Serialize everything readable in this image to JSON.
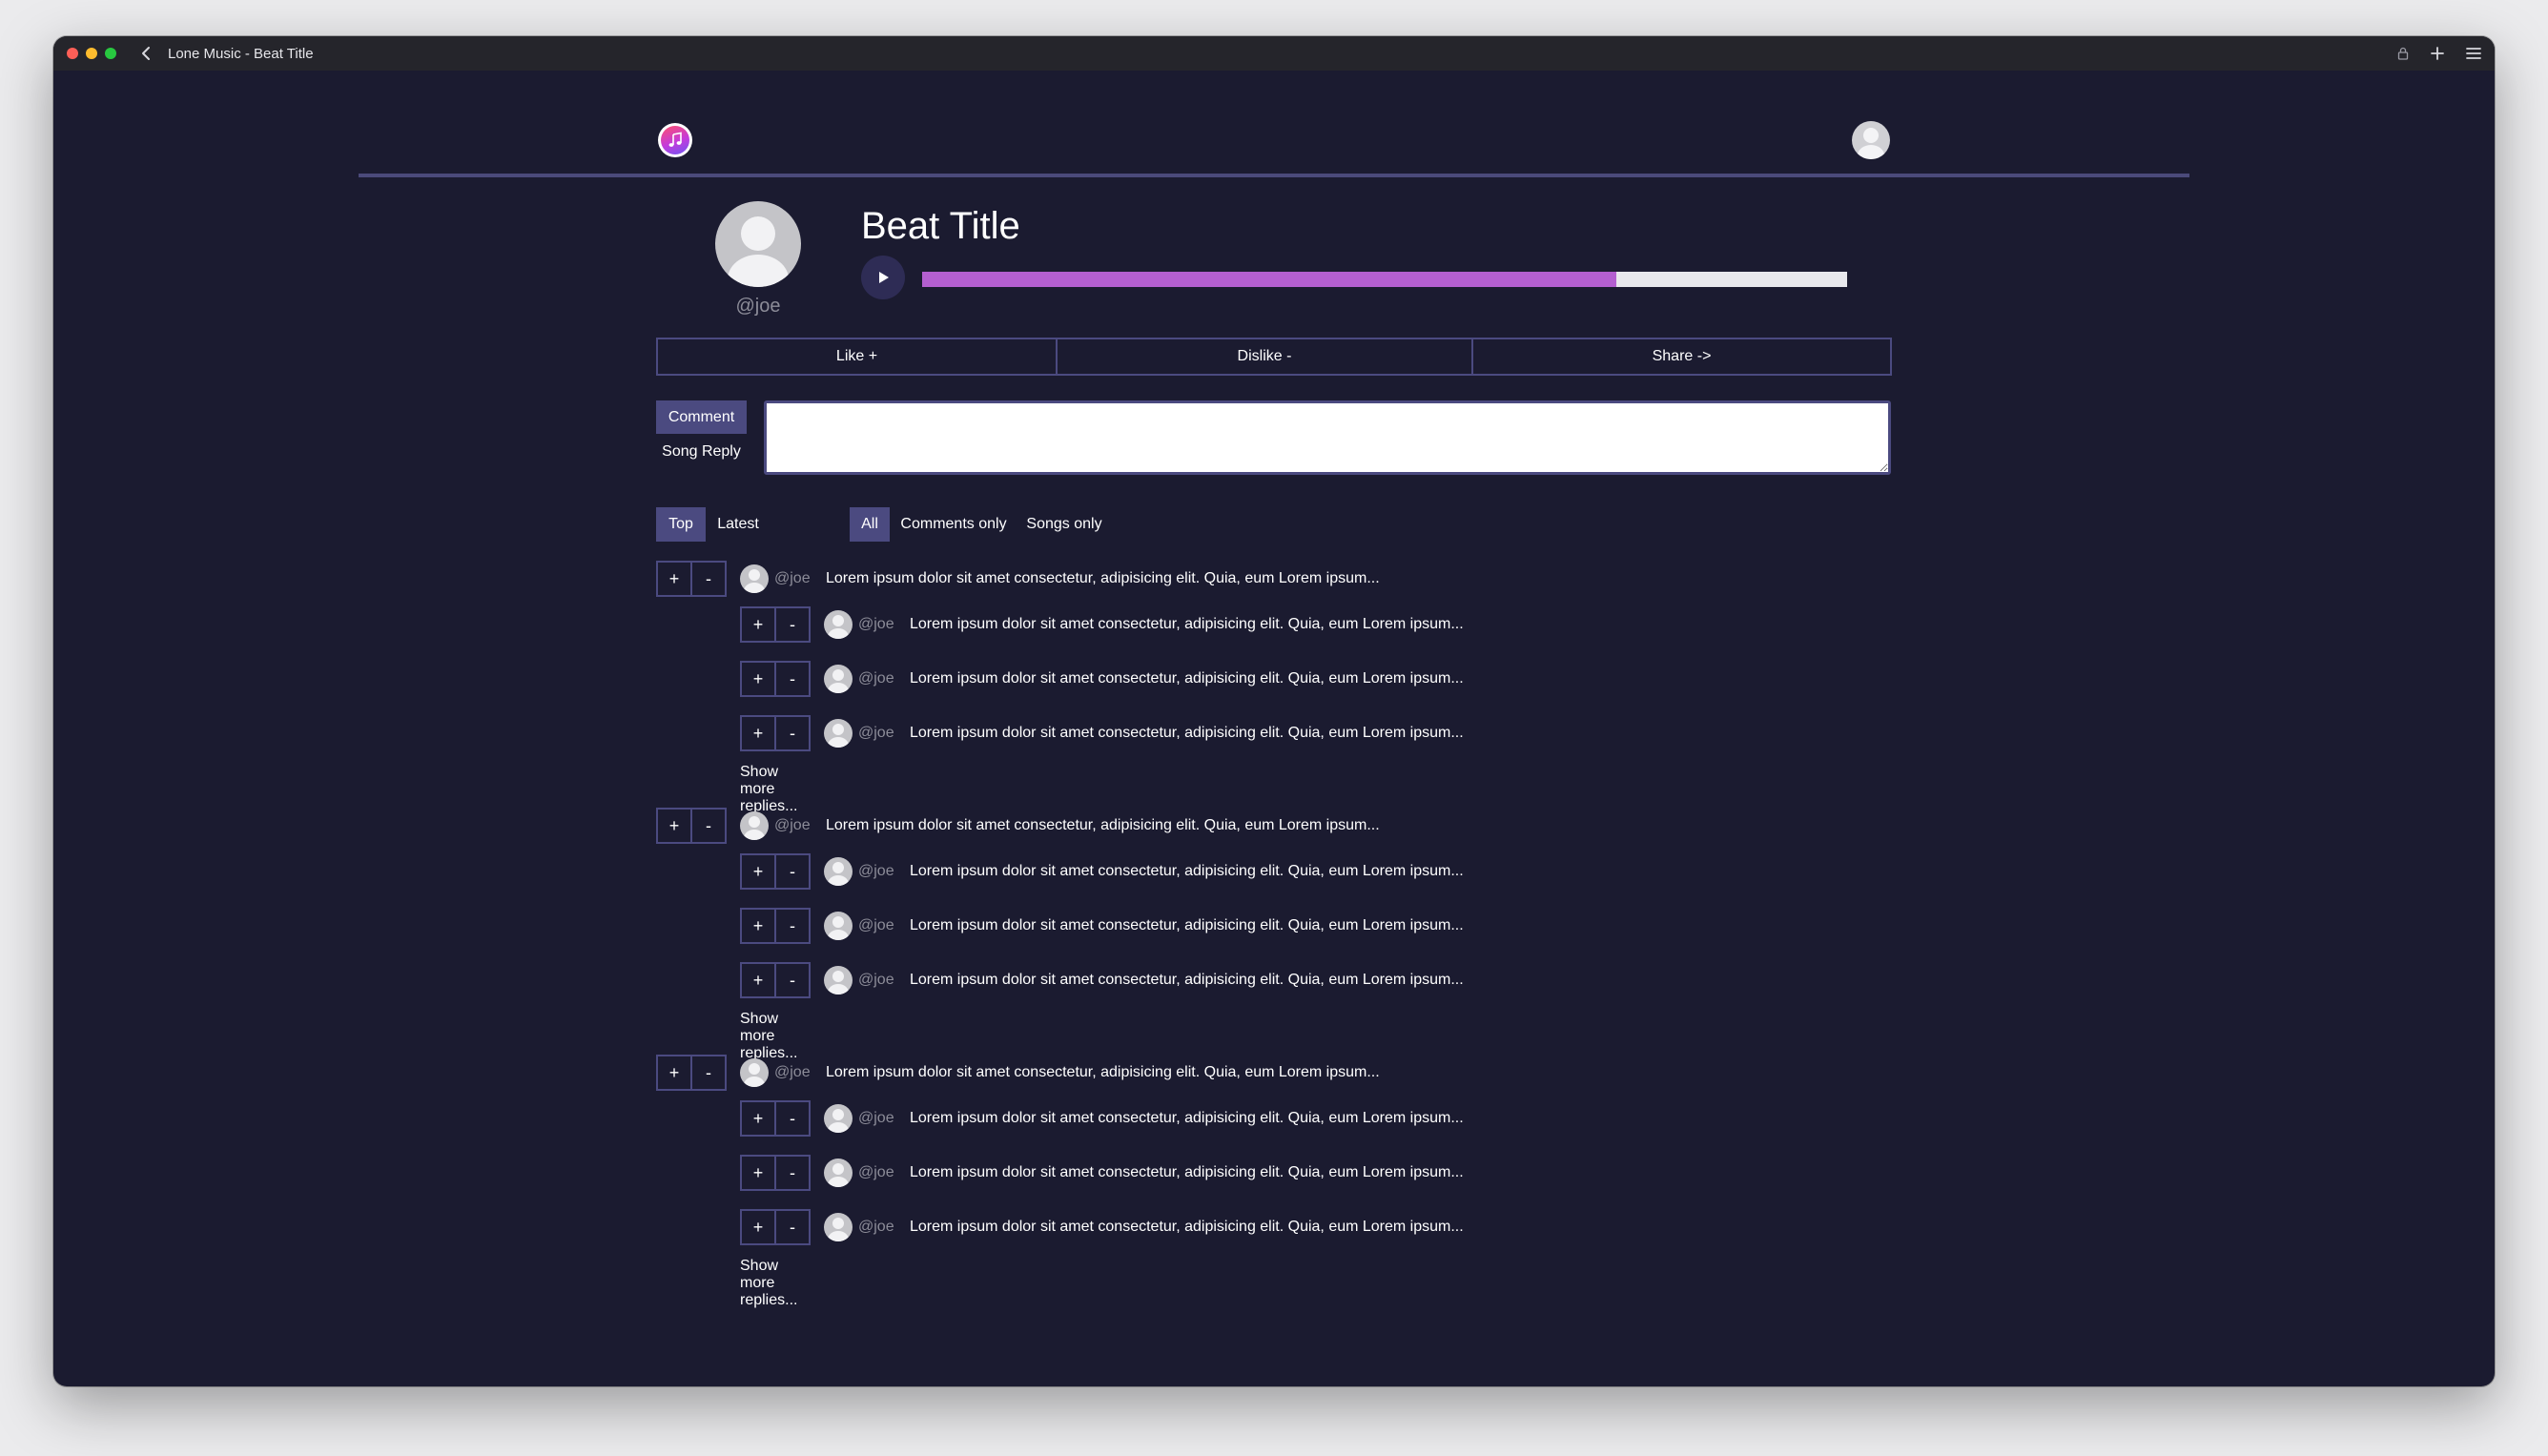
{
  "window": {
    "title": "Lone Music - Beat Title"
  },
  "header": {
    "logo_icon": "music-note-icon",
    "avatar_icon": "user-avatar-icon"
  },
  "beat": {
    "title": "Beat Title",
    "artist_handle": "@joe",
    "progress_fraction": 0.75
  },
  "actions": {
    "like_label": "Like +",
    "dislike_label": "Dislike -",
    "share_label": "Share ->"
  },
  "composer": {
    "comment_tab": "Comment",
    "song_reply_tab": "Song Reply",
    "input_value": "",
    "input_placeholder": ""
  },
  "sort": {
    "top_label": "Top",
    "latest_label": "Latest",
    "active": "Top"
  },
  "filter": {
    "all_label": "All",
    "comments_only_label": "Comments only",
    "songs_only_label": "Songs only",
    "active": "All"
  },
  "vote": {
    "up_label": "+",
    "down_label": "-"
  },
  "threads": [
    {
      "comment": {
        "handle": "@joe",
        "text": "Lorem ipsum dolor sit amet consectetur, adipisicing elit. Quia, eum Lorem ipsum..."
      },
      "replies": [
        {
          "handle": "@joe",
          "text": "Lorem ipsum dolor sit amet consectetur, adipisicing elit. Quia, eum Lorem ipsum..."
        },
        {
          "handle": "@joe",
          "text": "Lorem ipsum dolor sit amet consectetur, adipisicing elit. Quia, eum Lorem ipsum..."
        },
        {
          "handle": "@joe",
          "text": "Lorem ipsum dolor sit amet consectetur, adipisicing elit. Quia, eum Lorem ipsum..."
        }
      ],
      "show_more_label": "Show more replies..."
    },
    {
      "comment": {
        "handle": "@joe",
        "text": "Lorem ipsum dolor sit amet consectetur, adipisicing elit. Quia, eum Lorem ipsum..."
      },
      "replies": [
        {
          "handle": "@joe",
          "text": "Lorem ipsum dolor sit amet consectetur, adipisicing elit. Quia, eum Lorem ipsum..."
        },
        {
          "handle": "@joe",
          "text": "Lorem ipsum dolor sit amet consectetur, adipisicing elit. Quia, eum Lorem ipsum..."
        },
        {
          "handle": "@joe",
          "text": "Lorem ipsum dolor sit amet consectetur, adipisicing elit. Quia, eum Lorem ipsum..."
        }
      ],
      "show_more_label": "Show more replies..."
    },
    {
      "comment": {
        "handle": "@joe",
        "text": "Lorem ipsum dolor sit amet consectetur, adipisicing elit. Quia, eum Lorem ipsum..."
      },
      "replies": [
        {
          "handle": "@joe",
          "text": "Lorem ipsum dolor sit amet consectetur, adipisicing elit. Quia, eum Lorem ipsum..."
        },
        {
          "handle": "@joe",
          "text": "Lorem ipsum dolor sit amet consectetur, adipisicing elit. Quia, eum Lorem ipsum..."
        },
        {
          "handle": "@joe",
          "text": "Lorem ipsum dolor sit amet consectetur, adipisicing elit. Quia, eum Lorem ipsum..."
        }
      ],
      "show_more_label": "Show more replies..."
    }
  ],
  "colors": {
    "background": "#1b1b30",
    "accent": "#4b4a80",
    "progress": "#b45fd0",
    "text": "#ffffff",
    "muted": "#8c8c98"
  }
}
